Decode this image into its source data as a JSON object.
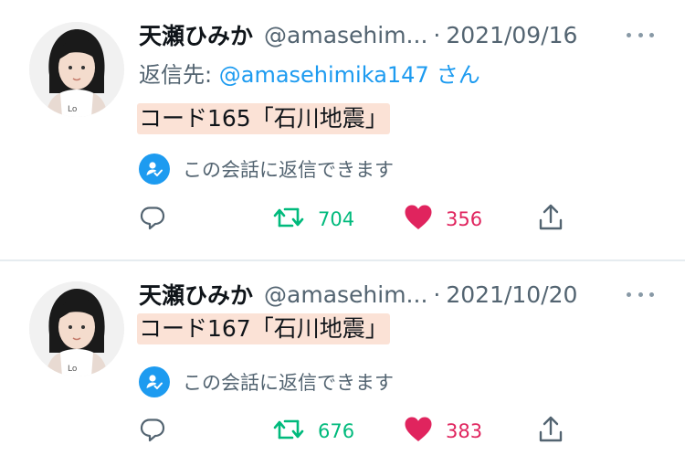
{
  "tweets": [
    {
      "display_name": "天瀬ひみか",
      "handle": "@amasehim...",
      "separator": "·",
      "date": "2021/09/16",
      "reply_to": {
        "prefix": "返信先:",
        "mention": "@amasehimika147",
        "suffix": "さん"
      },
      "text": "コード165「石川地震」",
      "conversation_notice": "この会話に返信できます",
      "retweets": "704",
      "likes": "356"
    },
    {
      "display_name": "天瀬ひみか",
      "handle": "@amasehim...",
      "separator": "·",
      "date": "2021/10/20",
      "text": "コード167「石川地震」",
      "conversation_notice": "この会話に返信できます",
      "retweets": "676",
      "likes": "383"
    }
  ],
  "icons": {
    "more": "more-horizontal-icon",
    "conversation": "person-check-icon",
    "reply": "reply-bubble-icon",
    "retweet": "retweet-icon",
    "like": "heart-icon",
    "share": "share-icon"
  },
  "colors": {
    "accent": "#1d9bf0",
    "retweet": "#00ba7c",
    "like": "#e0245e",
    "text_highlight": "#fbe2d6",
    "secondary_text": "#536471"
  }
}
